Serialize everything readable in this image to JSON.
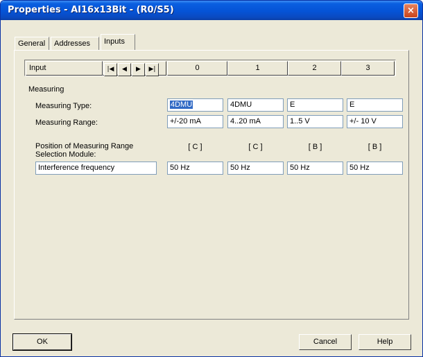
{
  "window": {
    "title": "Properties - AI16x13Bit - (R0/S5)",
    "close_glyph": "×"
  },
  "tabs": [
    {
      "label": "General"
    },
    {
      "label": "Addresses"
    },
    {
      "label": "Inputs",
      "active": true
    }
  ],
  "grid": {
    "header_label": "Input",
    "nav_icons": [
      "first-icon",
      "prev-icon",
      "next-icon",
      "last-icon"
    ],
    "channels": [
      "0",
      "1",
      "2",
      "3"
    ]
  },
  "measuring": {
    "section_label": "Measuring",
    "type_label": "Measuring Type:",
    "type_values": [
      "4DMU",
      "4DMU",
      "E",
      "E"
    ],
    "range_label": "Measuring Range:",
    "range_values": [
      "+/-20 mA",
      "4..20 mA",
      "1..5 V",
      "+/- 10 V"
    ],
    "position_label_line1": "Position of Measuring Range",
    "position_label_line2": "Selection Module:",
    "position_values": [
      "[ C ]",
      "[ C ]",
      "[ B ]",
      "[ B ]"
    ],
    "interference_label": "Interference frequency",
    "interference_values": [
      "50 Hz",
      "50 Hz",
      "50 Hz",
      "50 Hz"
    ]
  },
  "footer": {
    "ok_label": "OK",
    "cancel_label": "Cancel",
    "help_label": "Help"
  }
}
